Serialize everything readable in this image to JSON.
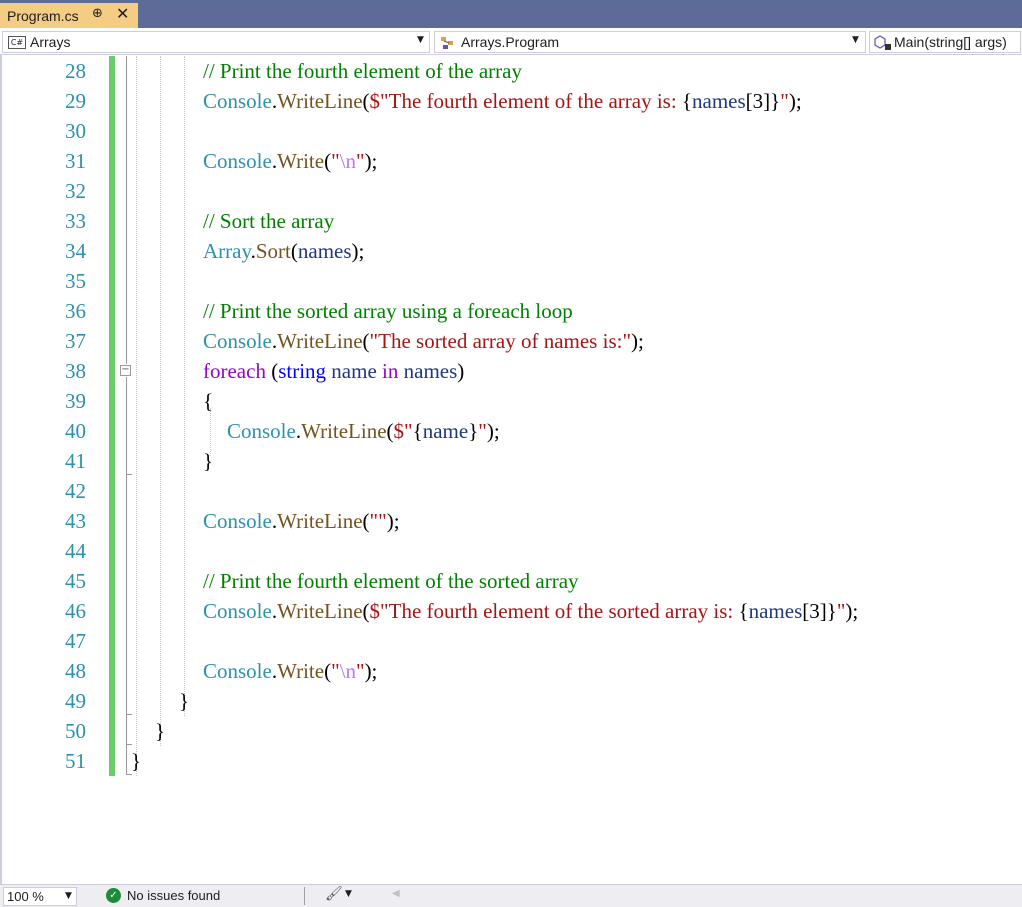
{
  "tab": {
    "title": "Program.cs",
    "pin_glyph": "⊕",
    "close_glyph": "✕"
  },
  "nav": {
    "project_icon_text": "C#",
    "project": "Arrays",
    "class": "Arrays.Program",
    "member": "Main(string[] args)"
  },
  "editor": {
    "lines": [
      {
        "num": "28",
        "indent": 0,
        "tokens": [
          [
            "c-comment",
            "// Print the fourth element of the array"
          ]
        ]
      },
      {
        "num": "29",
        "indent": 0,
        "tokens": [
          [
            "c-type",
            "Console"
          ],
          [
            "c-punct",
            "."
          ],
          [
            "c-method",
            "WriteLine"
          ],
          [
            "c-punct",
            "("
          ],
          [
            "c-string",
            "$\"The fourth element of the array is: "
          ],
          [
            "c-punct",
            "{"
          ],
          [
            "c-var",
            "names"
          ],
          [
            "c-punct",
            "[3]}"
          ],
          [
            "c-string",
            "\""
          ],
          [
            "c-punct",
            ");"
          ]
        ]
      },
      {
        "num": "30",
        "indent": 0,
        "tokens": []
      },
      {
        "num": "31",
        "indent": 0,
        "tokens": [
          [
            "c-type",
            "Console"
          ],
          [
            "c-punct",
            "."
          ],
          [
            "c-method",
            "Write"
          ],
          [
            "c-punct",
            "("
          ],
          [
            "c-string",
            "\""
          ],
          [
            "c-escape",
            "\\n"
          ],
          [
            "c-string",
            "\""
          ],
          [
            "c-punct",
            ");"
          ]
        ]
      },
      {
        "num": "32",
        "indent": 0,
        "tokens": []
      },
      {
        "num": "33",
        "indent": 0,
        "tokens": [
          [
            "c-comment",
            "// Sort the array"
          ]
        ]
      },
      {
        "num": "34",
        "indent": 0,
        "tokens": [
          [
            "c-type",
            "Array"
          ],
          [
            "c-punct",
            "."
          ],
          [
            "c-method",
            "Sort"
          ],
          [
            "c-punct",
            "("
          ],
          [
            "c-var",
            "names"
          ],
          [
            "c-punct",
            ");"
          ]
        ]
      },
      {
        "num": "35",
        "indent": 0,
        "tokens": []
      },
      {
        "num": "36",
        "indent": 0,
        "tokens": [
          [
            "c-comment",
            "// Print the sorted array using a foreach loop"
          ]
        ]
      },
      {
        "num": "37",
        "indent": 0,
        "tokens": [
          [
            "c-type",
            "Console"
          ],
          [
            "c-punct",
            "."
          ],
          [
            "c-method",
            "WriteLine"
          ],
          [
            "c-punct",
            "("
          ],
          [
            "c-string",
            "\"The sorted array of names is:\""
          ],
          [
            "c-punct",
            ");"
          ]
        ]
      },
      {
        "num": "38",
        "indent": 0,
        "tokens": [
          [
            "c-ctrl",
            "foreach"
          ],
          [
            "c-punct",
            " ("
          ],
          [
            "c-kw",
            "string"
          ],
          [
            "c-punct",
            " "
          ],
          [
            "c-var",
            "name"
          ],
          [
            "c-punct",
            " "
          ],
          [
            "c-ctrl",
            "in"
          ],
          [
            "c-punct",
            " "
          ],
          [
            "c-var",
            "names"
          ],
          [
            "c-punct",
            ")"
          ]
        ]
      },
      {
        "num": "39",
        "indent": 0,
        "tokens": [
          [
            "c-punct",
            "{"
          ]
        ]
      },
      {
        "num": "40",
        "indent": 1,
        "tokens": [
          [
            "c-type",
            "Console"
          ],
          [
            "c-punct",
            "."
          ],
          [
            "c-method",
            "WriteLine"
          ],
          [
            "c-punct",
            "("
          ],
          [
            "c-string",
            "$\""
          ],
          [
            "c-punct",
            "{"
          ],
          [
            "c-var",
            "name"
          ],
          [
            "c-punct",
            "}"
          ],
          [
            "c-string",
            "\""
          ],
          [
            "c-punct",
            ");"
          ]
        ]
      },
      {
        "num": "41",
        "indent": 0,
        "tokens": [
          [
            "c-punct",
            "}"
          ]
        ]
      },
      {
        "num": "42",
        "indent": 0,
        "tokens": []
      },
      {
        "num": "43",
        "indent": 0,
        "tokens": [
          [
            "c-type",
            "Console"
          ],
          [
            "c-punct",
            "."
          ],
          [
            "c-method",
            "WriteLine"
          ],
          [
            "c-punct",
            "("
          ],
          [
            "c-string",
            "\"\""
          ],
          [
            "c-punct",
            ");"
          ]
        ]
      },
      {
        "num": "44",
        "indent": 0,
        "tokens": []
      },
      {
        "num": "45",
        "indent": 0,
        "tokens": [
          [
            "c-comment",
            "// Print the fourth element of the sorted array"
          ]
        ]
      },
      {
        "num": "46",
        "indent": 0,
        "tokens": [
          [
            "c-type",
            "Console"
          ],
          [
            "c-punct",
            "."
          ],
          [
            "c-method",
            "WriteLine"
          ],
          [
            "c-punct",
            "("
          ],
          [
            "c-string",
            "$\"The fourth element of the sorted array is: "
          ],
          [
            "c-punct",
            "{"
          ],
          [
            "c-var",
            "names"
          ],
          [
            "c-punct",
            "[3]}"
          ],
          [
            "c-string",
            "\""
          ],
          [
            "c-punct",
            ");"
          ]
        ]
      },
      {
        "num": "47",
        "indent": 0,
        "tokens": []
      },
      {
        "num": "48",
        "indent": 0,
        "tokens": [
          [
            "c-type",
            "Console"
          ],
          [
            "c-punct",
            "."
          ],
          [
            "c-method",
            "Write"
          ],
          [
            "c-punct",
            "("
          ],
          [
            "c-string",
            "\""
          ],
          [
            "c-escape",
            "\\n"
          ],
          [
            "c-string",
            "\""
          ],
          [
            "c-punct",
            ");"
          ]
        ]
      },
      {
        "num": "49",
        "indent": -1,
        "tokens": [
          [
            "c-punct",
            "}"
          ]
        ]
      },
      {
        "num": "50",
        "indent": -2,
        "tokens": [
          [
            "c-punct",
            "}"
          ]
        ]
      },
      {
        "num": "51",
        "indent": -3,
        "tokens": [
          [
            "c-punct",
            "}"
          ]
        ]
      }
    ]
  },
  "status": {
    "zoom": "100 %",
    "issues": "No issues found"
  },
  "icons": {
    "pin": "pin-icon",
    "close": "close-icon",
    "project": "csharp-project-icon",
    "class": "class-icon",
    "member": "method-icon",
    "issues": "check-circle-icon",
    "cleanup": "brush-icon"
  }
}
